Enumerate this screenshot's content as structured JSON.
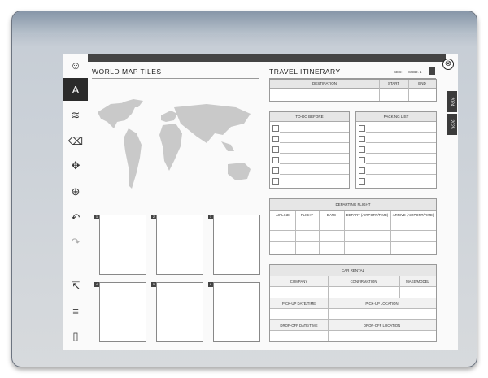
{
  "toolbar": {
    "items": [
      {
        "name": "user-icon",
        "glyph": "☺"
      },
      {
        "name": "pen-icon",
        "glyph": "A"
      },
      {
        "name": "strokes-icon",
        "glyph": "≋"
      },
      {
        "name": "eraser-icon",
        "glyph": "⌫"
      },
      {
        "name": "move-icon",
        "glyph": "✥"
      },
      {
        "name": "zoom-icon",
        "glyph": "⊕"
      },
      {
        "name": "undo-icon",
        "glyph": "↶"
      },
      {
        "name": "redo-icon",
        "glyph": "↷"
      },
      {
        "name": "export-icon",
        "glyph": "⇱"
      },
      {
        "name": "layers-icon",
        "glyph": "≡"
      },
      {
        "name": "page-icon",
        "glyph": "▯"
      }
    ]
  },
  "close_glyph": "⊗",
  "left": {
    "title": "WORLD MAP TILES",
    "tiles": [
      "1",
      "2",
      "3",
      "4",
      "5",
      "6"
    ]
  },
  "right": {
    "title": "TRAVEL ITINERARY",
    "header_sec": "SEC:",
    "header_sub": "SUBJ. 1",
    "destination_table": {
      "col1": "DESTINATION",
      "col2": "START",
      "col3": "END"
    },
    "todo": {
      "title": "TO-DO BEFORE"
    },
    "packing": {
      "title": "PACKING LIST"
    },
    "flight": {
      "title": "DEPARTING FLIGHT",
      "cols": [
        "AIRLINE",
        "FLIGHT",
        "DATE",
        "DEPART (AIRPORT/TIME)",
        "ARRIVE (AIRPORT/TIME)"
      ]
    },
    "car": {
      "title": "CAR RENTAL",
      "cols": [
        "COMPANY",
        "CONFIRMATION",
        "MAKE/MODEL"
      ],
      "pickup_date": "PICK-UP DATE/TIME",
      "pickup_loc": "PICK-UP LOCATION",
      "dropoff_date": "DROP-OFF DATE/TIME",
      "dropoff_loc": "DROP-OFF LOCATION"
    }
  },
  "side_tabs": [
    "2024",
    "2025"
  ]
}
